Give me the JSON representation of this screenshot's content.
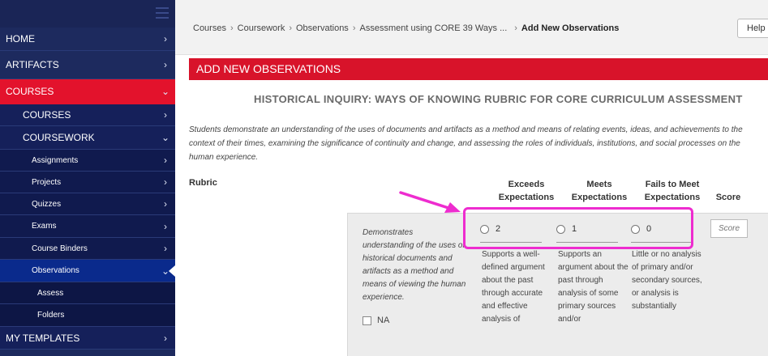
{
  "sidebar": {
    "items": [
      {
        "label": "HOME",
        "arrow": "›"
      },
      {
        "label": "ARTIFACTS",
        "arrow": "›"
      },
      {
        "label": "COURSES",
        "arrow": "⌄"
      },
      {
        "label": "COURSES",
        "arrow": "›"
      },
      {
        "label": "COURSEWORK",
        "arrow": "⌄"
      },
      {
        "label": "Assignments",
        "arrow": "›"
      },
      {
        "label": "Projects",
        "arrow": "›"
      },
      {
        "label": "Quizzes",
        "arrow": "›"
      },
      {
        "label": "Exams",
        "arrow": "›"
      },
      {
        "label": "Course Binders",
        "arrow": "›"
      },
      {
        "label": "Observations",
        "arrow": "⌄"
      },
      {
        "label": "Assess",
        "arrow": ""
      },
      {
        "label": "Folders",
        "arrow": ""
      },
      {
        "label": "MY TEMPLATES",
        "arrow": "›"
      }
    ]
  },
  "breadcrumb": {
    "items": [
      "Courses",
      "Coursework",
      "Observations",
      "Assessment using CORE 39 Ways ...",
      "Add New Observations"
    ],
    "separator": "›"
  },
  "header": {
    "help_label": "Help"
  },
  "page": {
    "banner_title": "ADD NEW OBSERVATIONS",
    "rubric_title": "HISTORICAL INQUIRY: WAYS OF KNOWING RUBRIC FOR CORE CURRICULUM ASSESSMENT",
    "description": "Students demonstrate an understanding of the uses of documents and artifacts as a method and means of relating events, ideas, and achievements to the context of their times, examining the significance of continuity and change, and assessing the roles of individuals, institutions, and social processes on the human experience.",
    "rubric_label": "Rubric"
  },
  "rubric": {
    "columns": [
      {
        "line1": "Exceeds",
        "line2": "Expectations"
      },
      {
        "line1": "Meets",
        "line2": "Expectations"
      },
      {
        "line1": "Fails to Meet",
        "line2": "Expectations"
      },
      {
        "line1": "Score",
        "line2": ""
      }
    ],
    "criterion": {
      "text": "Demonstrates understanding of the uses of historical documents and artifacts as a method and means of viewing the human experience.",
      "na_label": "NA",
      "levels": [
        {
          "value": "2",
          "text": "Supports a well-defined argument about the past through accurate and effective analysis of"
        },
        {
          "value": "1",
          "text": "Supports an argument about the past through analysis of some primary sources and/or"
        },
        {
          "value": "0",
          "text": "Little or no analysis of primary and/or secondary sources, or analysis is substantially"
        }
      ],
      "score_placeholder": "Score"
    }
  },
  "colors": {
    "sidebar_bg": "#1d2a5e",
    "accent_red": "#d8132a",
    "highlight_magenta": "#ee2ccf"
  }
}
